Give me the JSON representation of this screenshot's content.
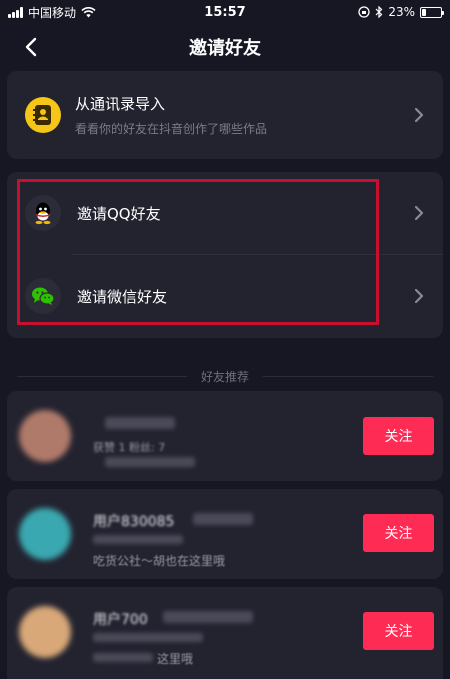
{
  "status_bar": {
    "carrier": "中国移动",
    "time": "15:57",
    "battery": "23%",
    "battery_level": 0.23
  },
  "nav": {
    "title": "邀请好友"
  },
  "contacts": {
    "title": "从通讯录导入",
    "subtitle": "看看你的好友在抖音创作了哪些作品"
  },
  "social": {
    "qq_label": "邀请QQ好友",
    "wechat_label": "邀请微信好友"
  },
  "section": {
    "recommend_label": "好友推荐"
  },
  "friends": [
    {
      "name": "",
      "meta": "获赞 1  粉丝: 7",
      "desc": "",
      "follow_label": "关注",
      "avatar_color": "#b07a6a"
    },
    {
      "name": "用户830085",
      "meta": "",
      "desc": "吃货公社～胡也在这里哦",
      "follow_label": "关注",
      "avatar_color": "#3aa8b0"
    },
    {
      "name": "用户700",
      "meta": "",
      "desc": "这里哦",
      "follow_label": "关注",
      "avatar_color": "#d8a878"
    }
  ],
  "colors": {
    "background": "#171724",
    "card": "#232330",
    "accent": "#fe2c55",
    "contacts_icon": "#f5c518",
    "wechat_green": "#2dc100",
    "highlight": "#c8102e"
  }
}
